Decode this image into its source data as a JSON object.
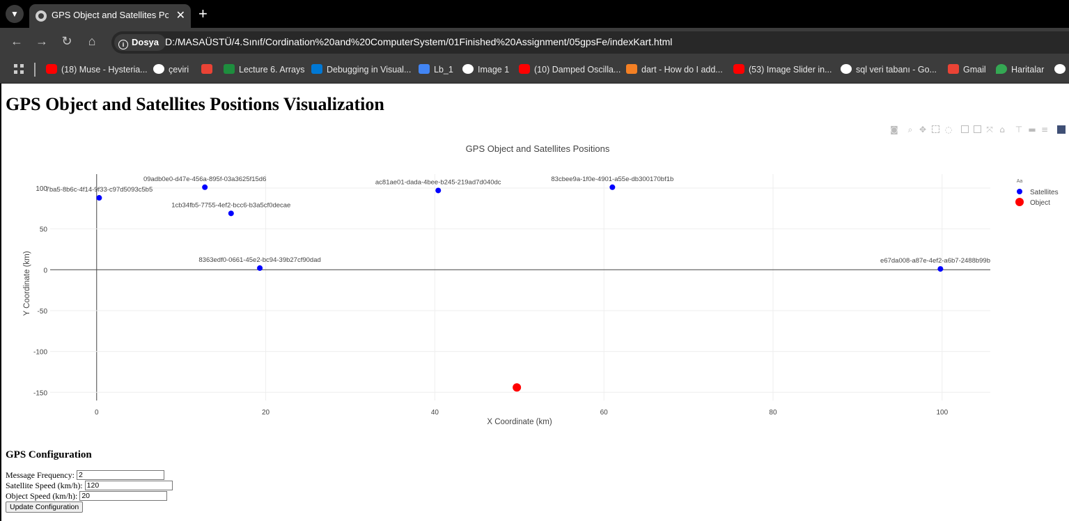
{
  "browser": {
    "tab_title": "GPS Object and Satellites Position",
    "site_chip": "Dosya",
    "url": "D:/MASAÜSTÜ/4.Sınıf/Cordination%20and%20ComputerSystem/01Finished%20Assignment/05gpsFe/indexKart.html",
    "bookmarks": [
      {
        "label": "(18) Muse - Hysteria...",
        "icon": "youtube-icon"
      },
      {
        "label": "çeviri",
        "icon": "google-icon"
      },
      {
        "label": "",
        "icon": "gmail-icon"
      },
      {
        "label": "Lecture 6. Arrays",
        "icon": "classroom-icon"
      },
      {
        "label": "Debugging in Visual...",
        "icon": "vscode-icon"
      },
      {
        "label": "Lb_1",
        "icon": "user-icon"
      },
      {
        "label": "Image 1",
        "icon": "globe-icon"
      },
      {
        "label": "(10) Damped Oscilla...",
        "icon": "youtube-icon"
      },
      {
        "label": "dart - How do I add...",
        "icon": "stackoverflow-icon"
      },
      {
        "label": "(53) Image Slider in...",
        "icon": "youtube-icon"
      },
      {
        "label": "sql veri tabanı - Go...",
        "icon": "google-icon"
      },
      {
        "label": "Gmail",
        "icon": "gmail-icon"
      },
      {
        "label": "Haritalar",
        "icon": "maps-icon"
      }
    ]
  },
  "page": {
    "title": "GPS Object and Satellites Positions Visualization"
  },
  "chart_data": {
    "type": "scatter",
    "title": "GPS Object and Satellites Positions",
    "xlabel": "X Coordinate (km)",
    "ylabel": "Y Coordinate (km)",
    "xlim": [
      -5.5,
      105.7
    ],
    "ylim": [
      -160,
      117
    ],
    "x_ticks": [
      0,
      20,
      40,
      60,
      80,
      100
    ],
    "y_ticks": [
      100,
      50,
      0,
      -50,
      -100,
      -150
    ],
    "grid": true,
    "legend_position": "top-right",
    "legend_title": "Aa",
    "series": [
      {
        "name": "Satellites",
        "color": "#0000ff",
        "points": [
          {
            "x": 0.3,
            "y": 88,
            "label": "7ba5-8b6c-4f14-9f33-c97d5093c5b5"
          },
          {
            "x": 12.8,
            "y": 101,
            "label": "09adb0e0-d47e-456a-895f-03a3625f15d6"
          },
          {
            "x": 15.9,
            "y": 69,
            "label": "1cb34fb5-7755-4ef2-bcc6-b3a5cf0decae"
          },
          {
            "x": 19.3,
            "y": 2,
            "label": "8363edf0-0661-45e2-bc94-39b27cf90dad"
          },
          {
            "x": 40.4,
            "y": 97,
            "label": "ac81ae01-dada-4bee-b245-219ad7d040dc"
          },
          {
            "x": 61.0,
            "y": 101,
            "label": "83cbee9a-1f0e-4901-a55e-db300170bf1b"
          },
          {
            "x": 99.8,
            "y": 1,
            "label": "e67da008-a87e-4ef2-a6b7-2488b99b"
          }
        ]
      },
      {
        "name": "Object",
        "color": "#ff0000",
        "points": [
          {
            "x": 49.7,
            "y": -144
          }
        ]
      }
    ]
  },
  "config": {
    "heading": "GPS Configuration",
    "message_frequency_label": "Message Frequency:",
    "message_frequency_value": "2",
    "satellite_speed_label": "Satellite Speed (km/h):",
    "satellite_speed_value": "120",
    "object_speed_label": "Object Speed (km/h):",
    "object_speed_value": "20",
    "update_button": "Update Configuration"
  }
}
